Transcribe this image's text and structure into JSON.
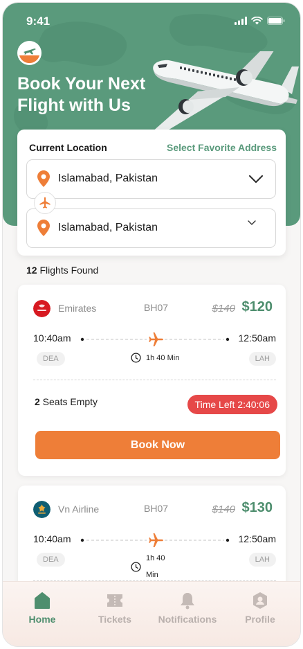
{
  "status_bar": {
    "time": "9:41"
  },
  "hero": {
    "title_line1": "Book Your Next",
    "title_line2": "Flight with Us"
  },
  "search": {
    "current_location_label": "Current Location",
    "favorite_link": "Select Favorite Address",
    "from_value": "Islamabad, Pakistan",
    "to_value": "Islamabad, Pakistan"
  },
  "results": {
    "count": "12",
    "suffix": " Flights Found"
  },
  "flights": [
    {
      "airline": "Emirates",
      "code": "BH07",
      "price_old": "$140",
      "price_new": "$120",
      "dep_time": "10:40am",
      "arr_time": "12:50am",
      "dep_airport": "DEA",
      "arr_airport": "LAH",
      "duration": "1h 40 Min",
      "seats_count": "2",
      "seats_suffix": " Seats Empty",
      "time_left_label": "Time Left",
      "time_left_value": "2:40:06",
      "book_label": "Book Now"
    },
    {
      "airline": "Vn Airline",
      "code": "BH07",
      "price_old": "$140",
      "price_new": "$130",
      "dep_time": "10:40am",
      "arr_time": "12:50am",
      "dep_airport": "DEA",
      "arr_airport": "LAH",
      "duration_line1": "1h 40",
      "duration_line2": "Min"
    }
  ],
  "tabs": [
    {
      "label": "Home",
      "icon": "home-icon",
      "active": true
    },
    {
      "label": "Tickets",
      "icon": "ticket-icon",
      "active": false
    },
    {
      "label": "Notifications",
      "icon": "bell-icon",
      "active": false
    },
    {
      "label": "Profile",
      "icon": "profile-icon",
      "active": false
    }
  ],
  "colors": {
    "brand_green": "#5a9a7c",
    "accent_orange": "#ee7e38",
    "alert_red": "#e64848",
    "price_green": "#4e8e6e"
  }
}
